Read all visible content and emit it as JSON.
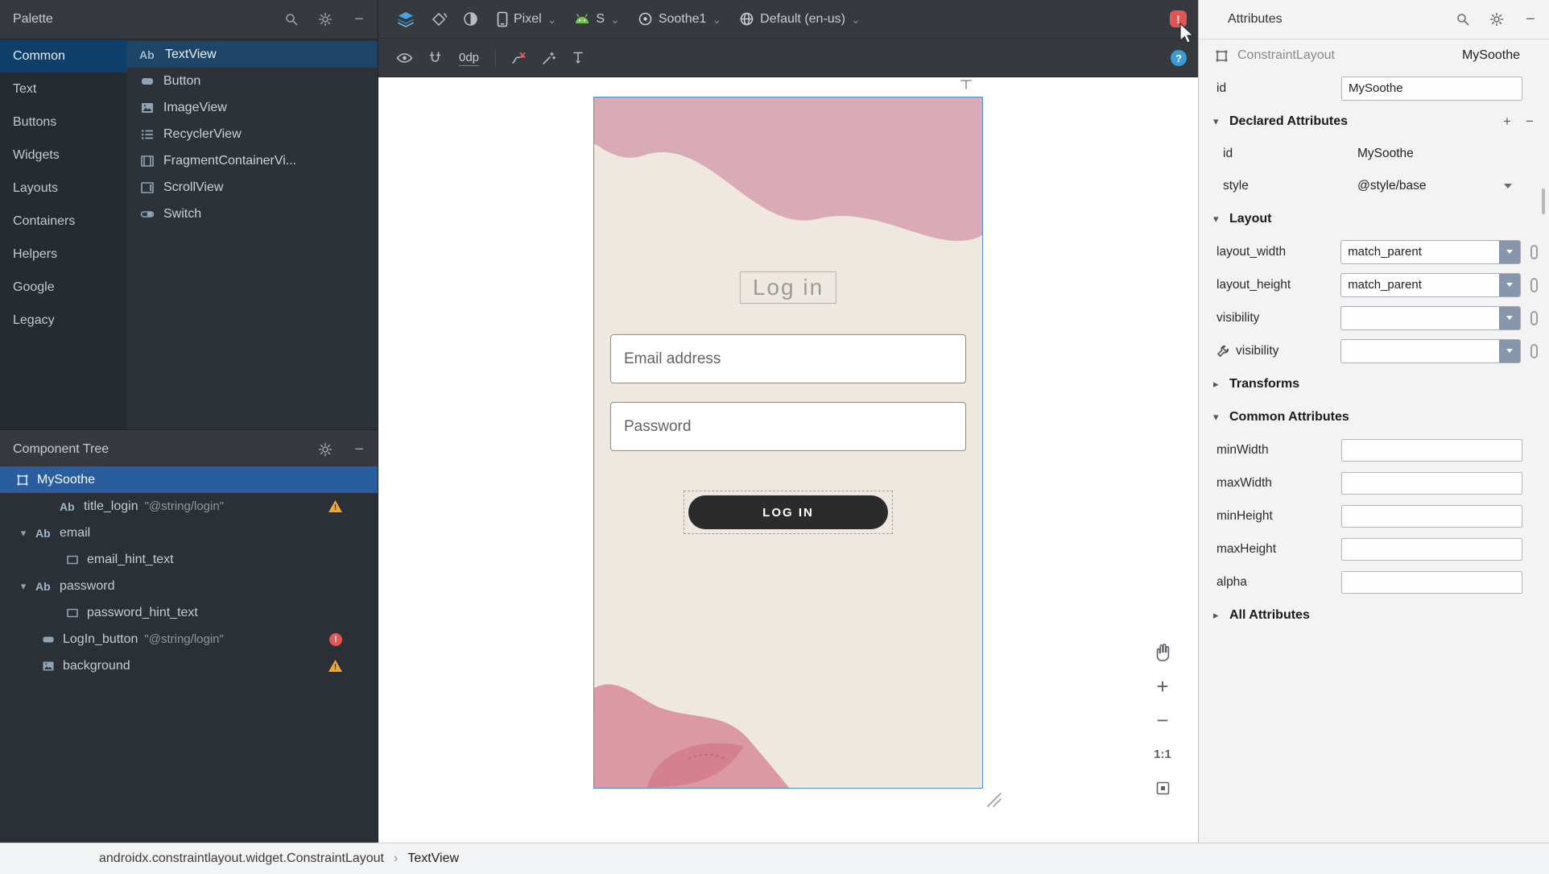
{
  "colors": {
    "selection_blue": "#2a5d9d",
    "category_selection": "#0e3f6a",
    "error_red": "#e45454",
    "warning_yellow": "#f0a732",
    "accent_blue": "#3a9bd5",
    "device_background": "#efe8e1",
    "blob_pink": "#d9abb6",
    "blob_pink_dark": "#d5808e",
    "login_button_background": "#2b2b2b"
  },
  "icons": {
    "ab": "Ab",
    "bang": "!",
    "question": "?",
    "chevron_down": "⌄",
    "expanded": "▾",
    "collapsed": "▸",
    "plus": "+",
    "minus": "−"
  },
  "palette": {
    "title": "Palette",
    "categories": [
      {
        "label": "Common"
      },
      {
        "label": "Text"
      },
      {
        "label": "Buttons"
      },
      {
        "label": "Widgets"
      },
      {
        "label": "Layouts"
      },
      {
        "label": "Containers"
      },
      {
        "label": "Helpers"
      },
      {
        "label": "Google"
      },
      {
        "label": "Legacy"
      }
    ],
    "components": [
      {
        "label": "TextView"
      },
      {
        "label": "Button"
      },
      {
        "label": "ImageView"
      },
      {
        "label": "RecyclerView"
      },
      {
        "label": "FragmentContainerVi..."
      },
      {
        "label": "ScrollView"
      },
      {
        "label": "Switch"
      }
    ]
  },
  "component_tree": {
    "title": "Component Tree",
    "items": [
      {
        "label": "MySoothe"
      },
      {
        "label": "title_login",
        "value": "\"@string/login\""
      },
      {
        "label": "email"
      },
      {
        "label": "email_hint_text"
      },
      {
        "label": "password"
      },
      {
        "label": "password_hint_text"
      },
      {
        "label": "LogIn_button",
        "value": "\"@string/login\""
      },
      {
        "label": "background"
      }
    ]
  },
  "toolbar": {
    "device_label": "Pixel",
    "api_label": "S",
    "theme_label": "Soothe1",
    "locale_label": "Default (en-us)",
    "margin_label": "0dp"
  },
  "canvas": {
    "title_text": "Log in",
    "email_hint": "Email address",
    "password_hint": "Password",
    "button_label": "LOG IN"
  },
  "zoom_controls": {
    "actual_size_label": "1:1"
  },
  "attributes": {
    "title": "Attributes",
    "component_type": "ConstraintLayout",
    "component_id": "MySoothe",
    "id_row": {
      "name": "id",
      "value": "MySoothe"
    },
    "declared": {
      "title": "Declared Attributes",
      "rows": [
        {
          "name": "id",
          "value": "MySoothe"
        },
        {
          "name": "style",
          "value": "@style/base"
        }
      ]
    },
    "layout": {
      "title": "Layout",
      "rows": [
        {
          "name": "layout_width",
          "value": "match_parent"
        },
        {
          "name": "layout_height",
          "value": "match_parent"
        },
        {
          "name": "visibility",
          "value": ""
        },
        {
          "name": "visibility",
          "value": ""
        }
      ]
    },
    "transforms": {
      "title": "Transforms"
    },
    "common": {
      "title": "Common Attributes",
      "rows": [
        {
          "name": "minWidth",
          "value": ""
        },
        {
          "name": "maxWidth",
          "value": ""
        },
        {
          "name": "minHeight",
          "value": ""
        },
        {
          "name": "maxHeight",
          "value": ""
        },
        {
          "name": "alpha",
          "value": ""
        }
      ]
    },
    "all": {
      "title": "All Attributes"
    }
  },
  "breadcrumb": {
    "path": "androidx.constraintlayout.widget.ConstraintLayout",
    "separator": "›",
    "current": "TextView"
  }
}
